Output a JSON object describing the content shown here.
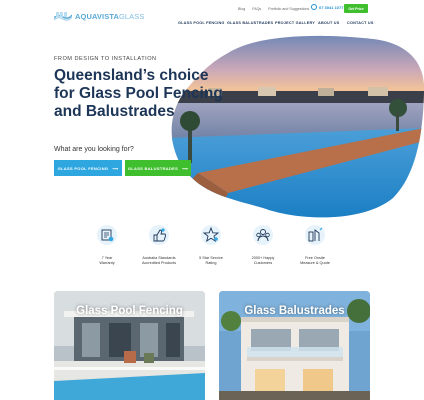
{
  "header": {
    "logo_primary": "AQUAVISTA",
    "logo_secondary": "GLASS",
    "utility_links": [
      "Blog",
      "FAQs",
      "Portfolio and Suggestions"
    ],
    "phone": "07 3041 1077",
    "quote_button": "Get Price",
    "nav": [
      "GLASS POOL FENCING",
      "GLASS BALUSTRADES",
      "PROJECT GALLERY",
      "ABOUT US",
      "CONTACT US"
    ]
  },
  "hero": {
    "eyebrow": "FROM DESIGN TO INSTALLATION",
    "headline": "Queensland’s choice for Glass Pool Fencing and Balustrades",
    "prompt": "What are you looking for?",
    "btn_pool": "GLASS POOL FENCING",
    "btn_balustrades": "GLASS BALUSTRADES",
    "arrow": "⟶"
  },
  "features": [
    {
      "icon": "warranty-icon",
      "line1": "7 Year",
      "line2": "Warranty"
    },
    {
      "icon": "thumbs-up-icon",
      "line1": "Australia Standards",
      "line2": "Accredited Products"
    },
    {
      "icon": "star-rating-icon",
      "line1": "5 Star Service",
      "line2": "Rating"
    },
    {
      "icon": "customers-icon",
      "line1": "2000+ Happy",
      "line2": "Customers"
    },
    {
      "icon": "measure-quote-icon",
      "line1": "Free Onsite",
      "line2": "Measure & Quote"
    }
  ],
  "cards": {
    "pool_title": "Glass Pool Fencing",
    "balustrades_title": "Glass Balustrades"
  },
  "colors": {
    "navy": "#1d3557",
    "blue": "#2ea6df",
    "green": "#3fbe2e",
    "logo_blue": "#5aa9d6"
  }
}
